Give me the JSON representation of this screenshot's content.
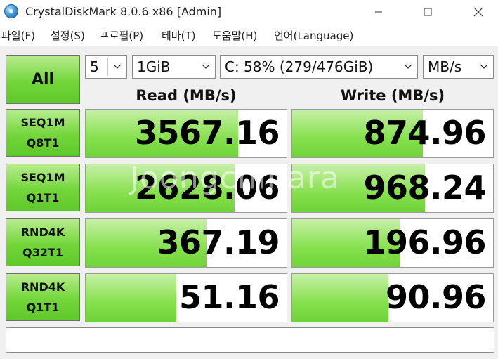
{
  "window": {
    "title": "CrystalDiskMark 8.0.6 x86 [Admin]",
    "icon": "crystaldiskmark-app-icon",
    "controls": [
      "minimize-icon",
      "maximize-icon",
      "close-icon"
    ]
  },
  "menu": [
    "파일(F)",
    "설정(S)",
    "프로필(P)",
    "테마(T)",
    "도움말(H)",
    "언어(Language)"
  ],
  "controls": {
    "all_label": "All",
    "count": "5",
    "size": "1GiB",
    "drive": "C: 58% (279/476GiB)",
    "unit": "MB/s"
  },
  "headers": {
    "read": "Read (MB/s)",
    "write": "Write (MB/s)"
  },
  "tests": [
    {
      "line1": "SEQ1M",
      "line2": "Q8T1",
      "read": "3567.16",
      "write": "874.96",
      "read_level": 0.76,
      "write_level": 0.65
    },
    {
      "line1": "SEQ1M",
      "line2": "Q1T1",
      "read": "2628.06",
      "write": "968.24",
      "read_level": 0.74,
      "write_level": 0.66
    },
    {
      "line1": "RND4K",
      "line2": "Q32T1",
      "read": "367.19",
      "write": "196.96",
      "read_level": 0.6,
      "write_level": 0.54
    },
    {
      "line1": "RND4K",
      "line2": "Q1T1",
      "read": "51.16",
      "write": "90.96",
      "read_level": 0.45,
      "write_level": 0.48
    }
  ],
  "watermark": "Joongchihara",
  "colors": {
    "accent_green": "#73d63a",
    "fill_green": "#86e04d"
  }
}
